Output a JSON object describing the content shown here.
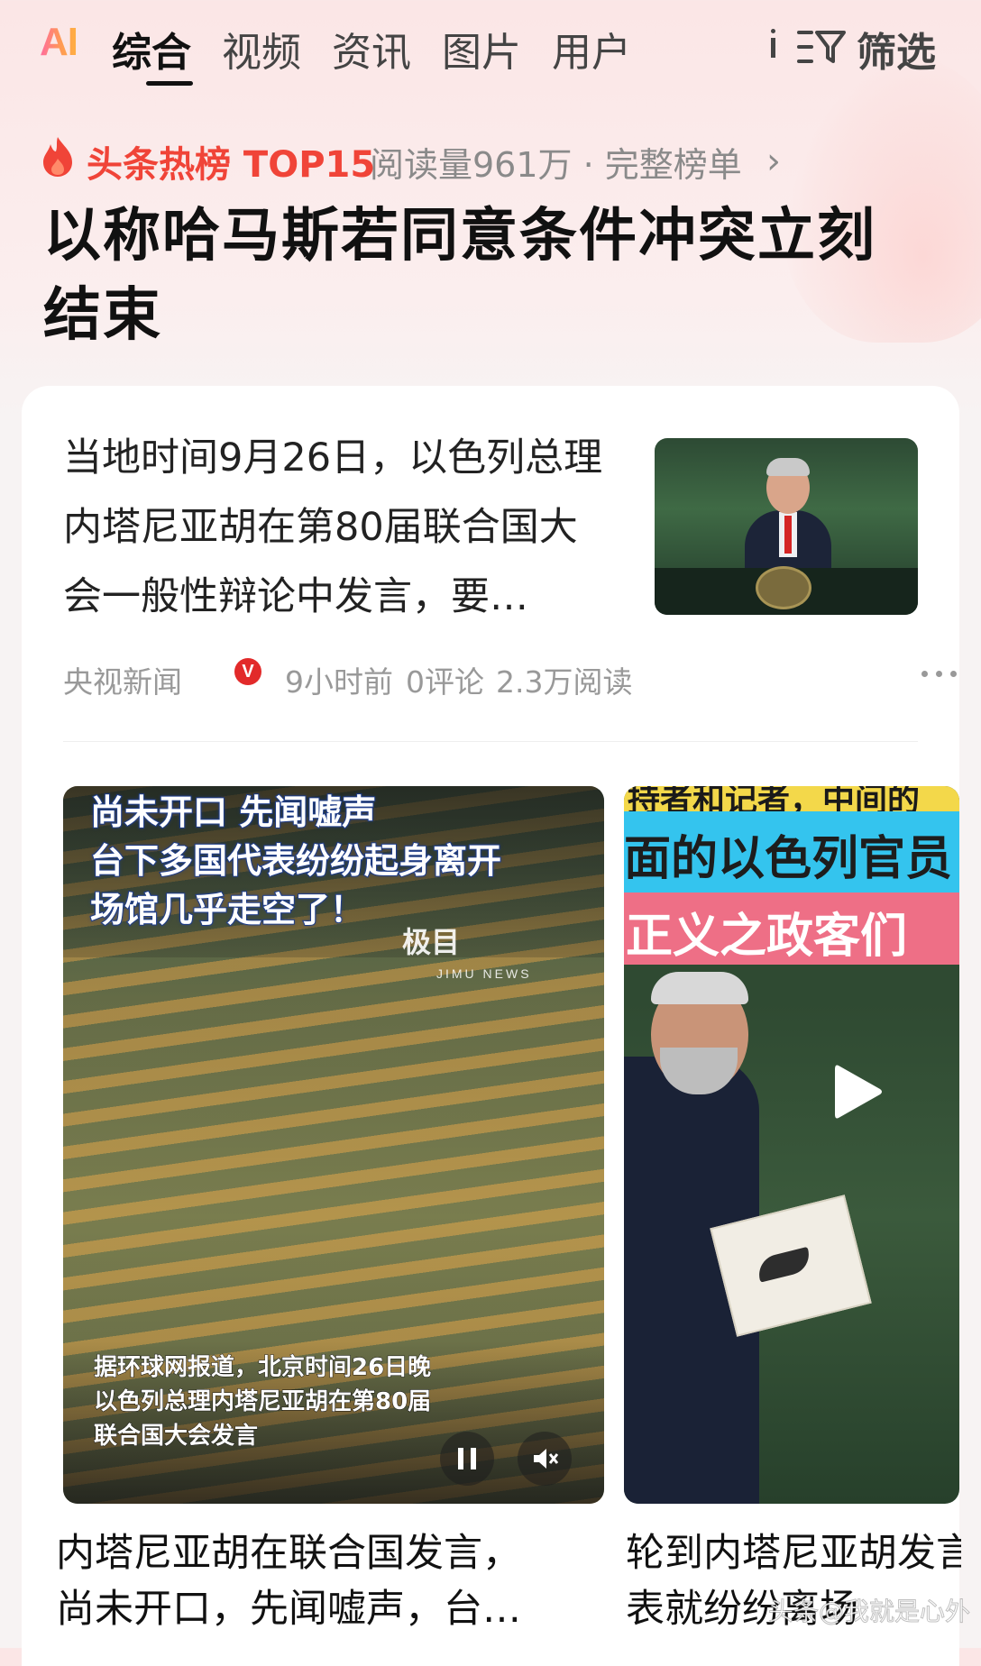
{
  "tabs": {
    "ai": "AI",
    "items": [
      "综合",
      "视频",
      "资讯",
      "图片",
      "用户"
    ],
    "active_index": 0,
    "filter_label": "筛选"
  },
  "hot": {
    "title": "头条热榜 TOP15",
    "meta": "阅读量961万 · 完整榜单",
    "headline": "以称哈马斯若同意条件冲突立刻结束"
  },
  "article": {
    "summary": "当地时间9月26日，以色列总理内塔尼亚胡在第80届联合国大会一般性辩论中发言，要…",
    "source": "央视新闻",
    "verified_badge": "V",
    "time": "9小时前",
    "comments": "0评论",
    "reads": "2.3万阅读"
  },
  "videos": [
    {
      "overlay_lines": [
        "尚未开口 先闻嘘声",
        "台下多国代表纷纷起身离开",
        "场馆几乎走空了！"
      ],
      "watermark": "极目",
      "watermark_sub": "JIMU NEWS",
      "caption_lines": [
        "据环球网报道，北京时间26日晚",
        "以色列总理内塔尼亚胡在第80届",
        "联合国大会发言"
      ],
      "title_lines": [
        "内塔尼亚胡在联合国发言，",
        "尚未开口，先闻嘘声，台…"
      ]
    },
    {
      "overlay_top": "持者和记者，中间的",
      "overlay_cyan": "面的以色列官员",
      "overlay_pink": "正义之政客们",
      "title_lines": [
        "轮到内塔尼亚胡发言",
        "表就纷纷离场"
      ]
    }
  ],
  "source_stamp": "头条@我就是心外",
  "colors": {
    "accent_red": "#f04438",
    "meta_gray": "#999999",
    "tab_active": "#111111"
  }
}
